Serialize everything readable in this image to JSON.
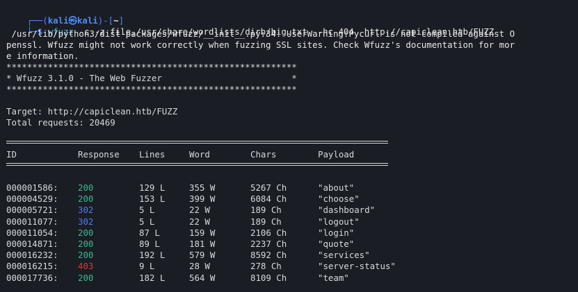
{
  "prompt": {
    "corner_top": "┌──(",
    "user": "kali㉿kali",
    "close_paren": ")-[",
    "dir": "~",
    "close_bracket": "]",
    "corner_bottom": "└─",
    "dollar": "$"
  },
  "command": {
    "name": "wfuzz",
    "args": "-c -z file,/usr/share/wordlists/dirb/big.txt --hc 404  http://capiclean.htb/FUZZ"
  },
  "warning_lines": [
    " /usr/lib/python3/dist-packages/wfuzz/__init__.py:34: UserWarning:Pycurl is not compiled against O",
    "penssl. Wfuzz might not work correctly when fuzzing SSL sites. Check Wfuzz's documentation for mor",
    "e information."
  ],
  "banner": {
    "border": "********************************************************",
    "title": "* Wfuzz 3.1.0 - The Web Fuzzer                         *"
  },
  "target": "Target: http://capiclean.htb/FUZZ",
  "total": "Total requests: 20469",
  "table": {
    "headers": [
      "ID",
      "Response",
      "Lines",
      "Word",
      "Chars",
      "Payload"
    ],
    "rows": [
      {
        "id": "000001586:",
        "code": "200",
        "lines": "129 L",
        "word": "355 W",
        "chars": "5267 Ch",
        "payload": "\"about\""
      },
      {
        "id": "000004529:",
        "code": "200",
        "lines": "153 L",
        "word": "399 W",
        "chars": "6084 Ch",
        "payload": "\"choose\""
      },
      {
        "id": "000005721:",
        "code": "302",
        "lines": "5 L",
        "word": "22 W",
        "chars": "189 Ch",
        "payload": "\"dashboard\""
      },
      {
        "id": "000011077:",
        "code": "302",
        "lines": "5 L",
        "word": "22 W",
        "chars": "189 Ch",
        "payload": "\"logout\""
      },
      {
        "id": "000011054:",
        "code": "200",
        "lines": "87 L",
        "word": "159 W",
        "chars": "2106 Ch",
        "payload": "\"login\""
      },
      {
        "id": "000014871:",
        "code": "200",
        "lines": "89 L",
        "word": "181 W",
        "chars": "2237 Ch",
        "payload": "\"quote\""
      },
      {
        "id": "000016232:",
        "code": "200",
        "lines": "192 L",
        "word": "579 W",
        "chars": "8592 Ch",
        "payload": "\"services\""
      },
      {
        "id": "000016215:",
        "code": "403",
        "lines": "9 L",
        "word": "28 W",
        "chars": "278 Ch",
        "payload": "\"server-status\""
      },
      {
        "id": "000017736:",
        "code": "200",
        "lines": "182 L",
        "word": "564 W",
        "chars": "8109 Ch",
        "payload": "\"team\""
      }
    ]
  },
  "colors": {
    "background": "#1a1d23",
    "status_200": "#3fb891",
    "status_302": "#4a7ff0",
    "status_403": "#d43a3a",
    "prompt": "#4a8df7"
  }
}
